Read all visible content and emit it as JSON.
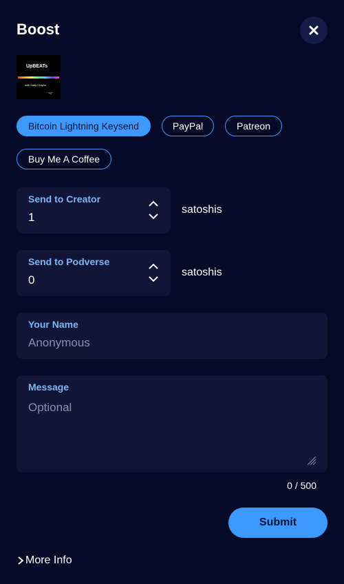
{
  "dialog": {
    "title": "Boost"
  },
  "artwork": {
    "title": "UpBEATs",
    "subtitle": "with Salty Crayon"
  },
  "payment_methods": [
    {
      "label": "Bitcoin Lightning Keysend",
      "active": true
    },
    {
      "label": "PayPal",
      "active": false
    },
    {
      "label": "Patreon",
      "active": false
    },
    {
      "label": "Buy Me A Coffee",
      "active": false
    }
  ],
  "creator_amount": {
    "label": "Send to Creator",
    "value": "1",
    "unit": "satoshis"
  },
  "podverse_amount": {
    "label": "Send to Podverse",
    "value": "0",
    "unit": "satoshis"
  },
  "name_field": {
    "label": "Your Name",
    "placeholder": "Anonymous"
  },
  "message_field": {
    "label": "Message",
    "placeholder": "Optional",
    "counter": "0 / 500"
  },
  "actions": {
    "submit_label": "Submit",
    "more_info_label": "More Info"
  },
  "colors": {
    "background": "#050a26",
    "accent": "#3d99ff",
    "field": "#111538",
    "label": "#7eb6f3"
  }
}
